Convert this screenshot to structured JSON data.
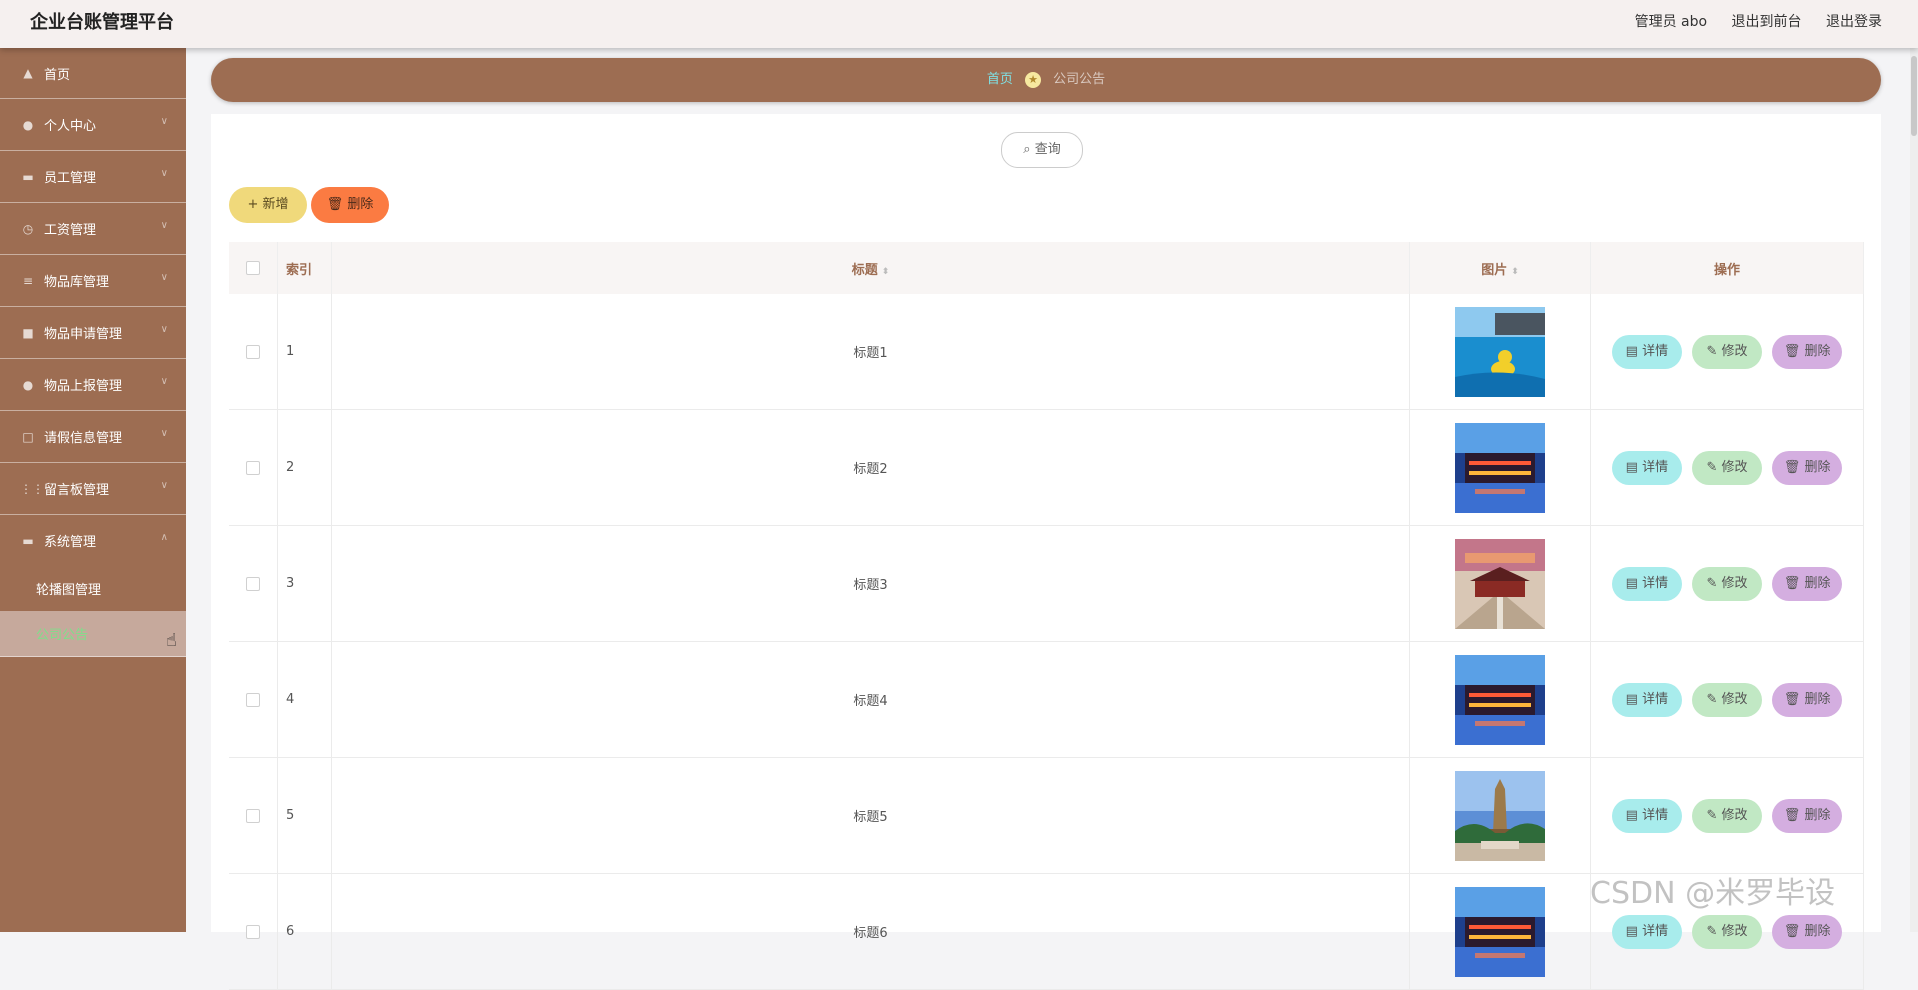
{
  "header": {
    "title": "企业台账管理平台",
    "user": "管理员 abo",
    "to_front": "退出到前台",
    "logout": "退出登录"
  },
  "sidebar": {
    "items": [
      {
        "label": "首页",
        "icon": "home-icon"
      },
      {
        "label": "个人中心",
        "icon": "user-icon"
      },
      {
        "label": "员工管理",
        "icon": "monitor-icon"
      },
      {
        "label": "工资管理",
        "icon": "clock-icon"
      },
      {
        "label": "物品库管理",
        "icon": "list-icon"
      },
      {
        "label": "物品申请管理",
        "icon": "video-icon"
      },
      {
        "label": "物品上报管理",
        "icon": "user-icon"
      },
      {
        "label": "请假信息管理",
        "icon": "square-icon"
      },
      {
        "label": "留言板管理",
        "icon": "grid-icon"
      },
      {
        "label": "系统管理",
        "icon": "server-icon"
      }
    ],
    "sub_items": [
      {
        "label": "轮播图管理"
      },
      {
        "label": "公司公告"
      }
    ]
  },
  "breadcrumb": {
    "home": "首页",
    "current": "公司公告"
  },
  "toolbar": {
    "search": "查询",
    "add": "新增",
    "delete": "删除"
  },
  "table": {
    "headers": {
      "index": "索引",
      "title": "标题",
      "image": "图片",
      "actions": "操作"
    },
    "rows": [
      {
        "index": "1",
        "title": "标题1",
        "image": "pool-duck"
      },
      {
        "index": "2",
        "title": "标题2",
        "image": "night-town"
      },
      {
        "index": "3",
        "title": "标题3",
        "image": "palace"
      },
      {
        "index": "4",
        "title": "标题4",
        "image": "night-town"
      },
      {
        "index": "5",
        "title": "标题5",
        "image": "tower"
      },
      {
        "index": "6",
        "title": "标题6",
        "image": "night-town"
      }
    ],
    "actions": {
      "detail": "详情",
      "edit": "修改",
      "delete": "删除"
    }
  },
  "watermark": "CSDN @米罗毕设",
  "colors": {
    "sidebar": "#9d6d52",
    "active_text": "#7ee08a",
    "add": "#f0d97b",
    "delete": "#fb7b42"
  }
}
